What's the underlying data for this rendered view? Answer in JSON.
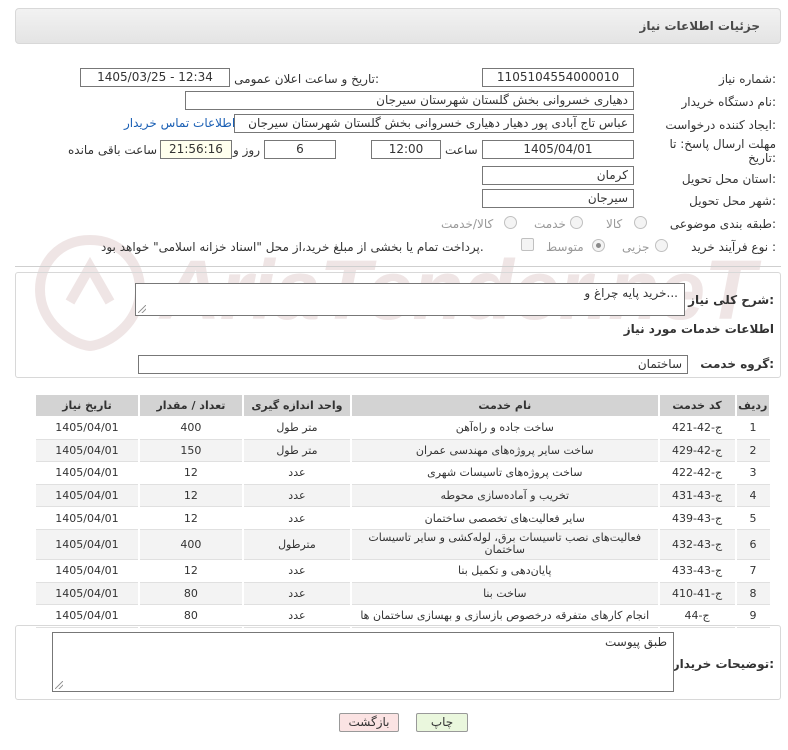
{
  "header": {
    "title": "جزئیات اطلاعات نیاز"
  },
  "form": {
    "need_number_label": "شماره نیاز:",
    "need_number": "1105104554000010",
    "announce_label": "تاریخ و ساعت اعلان عمومی:",
    "announce_value": "1405/03/25 - 12:34",
    "buyer_org_label": "نام دستگاه خریدار:",
    "buyer_org": "دهیاری خسروانی بخش گلستان شهرستان سیرجان",
    "requester_label": "ایجاد کننده درخواست:",
    "requester": "عباس تاج آبادی پور دهیار دهیاری خسروانی بخش گلستان شهرستان سیرجان",
    "contact_link": "اطلاعات تماس خریدار",
    "deadline_label": "مهلت ارسال پاسخ: تا تاریخ:",
    "deadline_date": "1405/04/01",
    "time_label": "ساعت",
    "deadline_time": "12:00",
    "days": "6",
    "days_label": "روز و",
    "remaining": "21:56:16",
    "remaining_label": "ساعت باقی مانده",
    "province_label": "استان محل تحویل:",
    "province": "کرمان",
    "city_label": "شهر محل تحویل:",
    "city": "سیرجان",
    "category_label": "طبقه بندی موضوعی:",
    "category_options": [
      "کالا",
      "خدمت",
      "کالا/خدمت"
    ],
    "process_label": "نوع فرآیند خرید :",
    "process_options": [
      "جزیی",
      "متوسط"
    ],
    "payment_note": "پرداخت تمام یا بخشی از مبلغ خرید،از محل \"اسناد خزانه اسلامی\" خواهد بود."
  },
  "summary": {
    "label": "شرح کلی نیاز:",
    "text": "خرید پایه چراغ و..."
  },
  "services": {
    "section_title": "اطلاعات خدمات مورد نیاز",
    "group_label": "گروه خدمت:",
    "group_value": "ساختمان",
    "columns": [
      "ردیف",
      "کد خدمت",
      "نام خدمت",
      "واحد اندازه گیری",
      "تعداد / مقدار",
      "تاریخ نیاز"
    ],
    "rows": [
      [
        "1",
        "ج-42-421",
        "ساخت جاده و راه‌آهن",
        "متر طول",
        "400",
        "1405/04/01"
      ],
      [
        "2",
        "ج-42-429",
        "ساخت سایر پروژه‌های مهندسی عمران",
        "متر طول",
        "150",
        "1405/04/01"
      ],
      [
        "3",
        "ج-42-422",
        "ساخت پروژه‌های تاسیسات شهری",
        "عدد",
        "12",
        "1405/04/01"
      ],
      [
        "4",
        "ج-43-431",
        "تخریب و آماده‌سازی محوطه",
        "عدد",
        "12",
        "1405/04/01"
      ],
      [
        "5",
        "ج-43-439",
        "سایر فعالیت‌های تخصصی ساختمان",
        "عدد",
        "12",
        "1405/04/01"
      ],
      [
        "6",
        "ج-43-432",
        "فعالیت‌های نصب تاسیسات برق، لوله‌کشی و سایر تاسیسات ساختمان",
        "مترطول",
        "400",
        "1405/04/01"
      ],
      [
        "7",
        "ج-43-433",
        "پایان‌دهی و تکمیل بنا",
        "عدد",
        "12",
        "1405/04/01"
      ],
      [
        "8",
        "ج-41-410",
        "ساخت بنا",
        "عدد",
        "80",
        "1405/04/01"
      ],
      [
        "9",
        "ج-44",
        "انجام کارهای متفرقه درخصوص بازسازی و بهسازی ساختمان ها",
        "عدد",
        "80",
        "1405/04/01"
      ]
    ]
  },
  "buyer_notes": {
    "label": "توضیحات خریدار:",
    "text": "طبق پیوست"
  },
  "buttons": {
    "print": "چاپ",
    "back": "بازگشت"
  }
}
